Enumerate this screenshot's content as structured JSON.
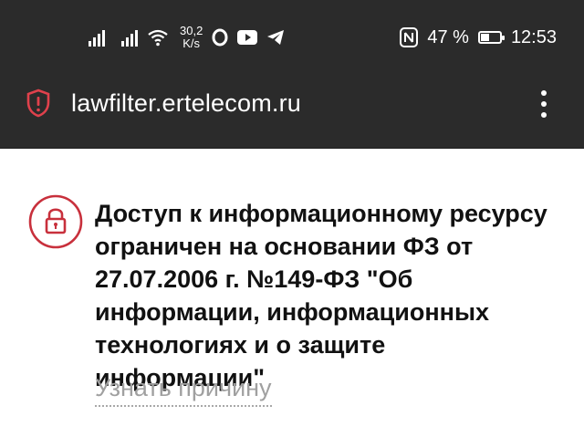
{
  "status_bar": {
    "net_speed_value": "30,2",
    "net_speed_unit": "K/s",
    "battery_percent": "47 %",
    "battery_level": 0.47,
    "time": "12:53",
    "icons": [
      "signal-icon",
      "signal-icon",
      "wifi-icon",
      "opera-icon",
      "youtube-icon",
      "telegram-icon",
      "nfc-icon",
      "battery-icon"
    ]
  },
  "browser": {
    "url": "lawfilter.ertelecom.ru",
    "site_info_icon": "shield-alert-icon",
    "menu_icon": "more-vert-icon"
  },
  "page": {
    "lock_icon": "lock-icon",
    "message": "Доступ к информационному ресурсу ограничен на основании ФЗ от 27.07.2006 г. №149-ФЗ \"Об информации, информационных технологиях и о защите информации\"",
    "reason_link": "Узнать причину"
  },
  "colors": {
    "bar_background": "#2b2b2b",
    "accent_red": "#c8303c",
    "link_gray": "#a0a0a0"
  }
}
